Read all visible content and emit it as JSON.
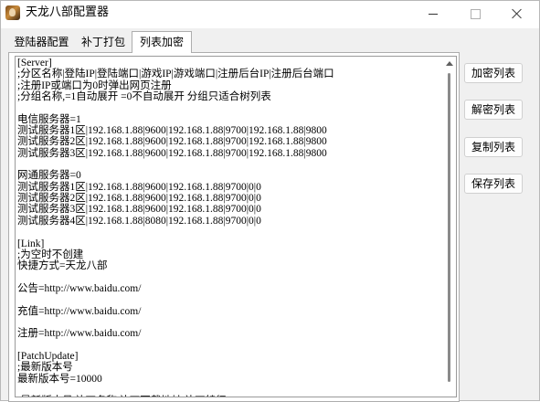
{
  "window": {
    "title": "天龙八部配置器",
    "minimize_label": "—",
    "maximize_label": "☐",
    "close_label": "✕"
  },
  "tabs": [
    {
      "label": "登陆器配置",
      "selected": false
    },
    {
      "label": "补丁打包",
      "selected": false
    },
    {
      "label": "列表加密",
      "selected": true
    }
  ],
  "editor": {
    "content": "[Server]\n;分区名称|登陆IP|登陆端口|游戏IP|游戏端口|注册后台IP|注册后台端口\n;注册IP或端口为0时弹出网页注册\n;分组名称,=1自动展开 =0不自动展开 分组只适合树列表\n\n电信服务器=1\n测试服务器1区|192.168.1.88|9600|192.168.1.88|9700|192.168.1.88|9800\n测试服务器2区|192.168.1.88|9600|192.168.1.88|9700|192.168.1.88|9800\n测试服务器3区|192.168.1.88|9600|192.168.1.88|9700|192.168.1.88|9800\n\n网通服务器=0\n测试服务器1区|192.168.1.88|9600|192.168.1.88|9700|0|0\n测试服务器2区|192.168.1.88|9600|192.168.1.88|9700|0|0\n测试服务器3区|192.168.1.88|9600|192.168.1.88|9700|0|0\n测试服务器4区|192.168.1.88|8080|192.168.1.88|9700|0|0\n\n[Link]\n;为空时不创建\n快捷方式=天龙八部\n\n公告=http://www.baidu.com/\n\n充值=http://www.baidu.com/\n\n注册=http://www.baidu.com/\n\n[PatchUpdate]\n;最新版本号\n最新版本号=10000\n\n;最新版本号|补丁名称|补丁下载地址|补丁特征"
  },
  "buttons": {
    "encrypt_list": "加密列表",
    "decrypt_list": "解密列表",
    "copy_list": "复制列表",
    "save_list": "保存列表"
  }
}
